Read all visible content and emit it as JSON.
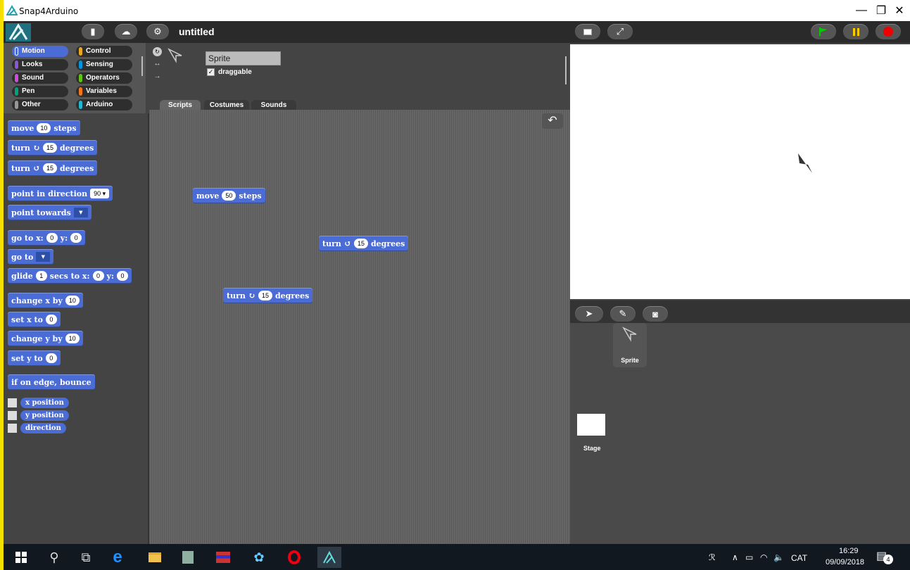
{
  "window": {
    "title": "Snap4Arduino"
  },
  "toolbar": {
    "project_title": "untitled"
  },
  "categories": [
    {
      "label": "Motion",
      "color": "#4a6cd4",
      "selected": true
    },
    {
      "label": "Control",
      "color": "#e6a822"
    },
    {
      "label": "Looks",
      "color": "#8a55d7"
    },
    {
      "label": "Sensing",
      "color": "#0494dc"
    },
    {
      "label": "Sound",
      "color": "#cf4ad9"
    },
    {
      "label": "Operators",
      "color": "#62c213"
    },
    {
      "label": "Pen",
      "color": "#00a178"
    },
    {
      "label": "Variables",
      "color": "#f3761d"
    },
    {
      "label": "Other",
      "color": "#969696"
    },
    {
      "label": "Arduino",
      "color": "#24b6d0"
    }
  ],
  "palette": {
    "move": {
      "a": "move",
      "v": "10",
      "b": "steps"
    },
    "turn_cw": {
      "a": "turn",
      "v": "15",
      "b": "degrees"
    },
    "turn_ccw": {
      "a": "turn",
      "v": "15",
      "b": "degrees"
    },
    "point_dir": {
      "a": "point in direction",
      "v": "90"
    },
    "point_towards": {
      "a": "point towards"
    },
    "goto_xy": {
      "a": "go to x:",
      "x": "0",
      "b": "y:",
      "y": "0"
    },
    "goto": {
      "a": "go to"
    },
    "glide": {
      "a": "glide",
      "s": "1",
      "b": "secs to x:",
      "x": "0",
      "c": "y:",
      "y": "0"
    },
    "change_x": {
      "a": "change x by",
      "v": "10"
    },
    "set_x": {
      "a": "set x to",
      "v": "0"
    },
    "change_y": {
      "a": "change y by",
      "v": "10"
    },
    "set_y": {
      "a": "set y to",
      "v": "0"
    },
    "bounce": {
      "a": "if on edge, bounce"
    },
    "reporters": [
      "x position",
      "y position",
      "direction"
    ]
  },
  "sprite": {
    "name": "Sprite",
    "draggable_label": "draggable"
  },
  "tabs": [
    "Scripts",
    "Costumes",
    "Sounds"
  ],
  "scripts": {
    "move": {
      "a": "move",
      "v": "50",
      "b": "steps"
    },
    "turn_ccw": {
      "a": "turn",
      "v": "15",
      "b": "degrees"
    },
    "turn_cw": {
      "a": "turn",
      "v": "15",
      "b": "degrees"
    }
  },
  "corral": {
    "sprite_label": "Sprite",
    "stage_label": "Stage"
  },
  "taskbar": {
    "lang": "CAT",
    "time": "16:29",
    "date": "09/09/2018",
    "notifications": "4"
  }
}
